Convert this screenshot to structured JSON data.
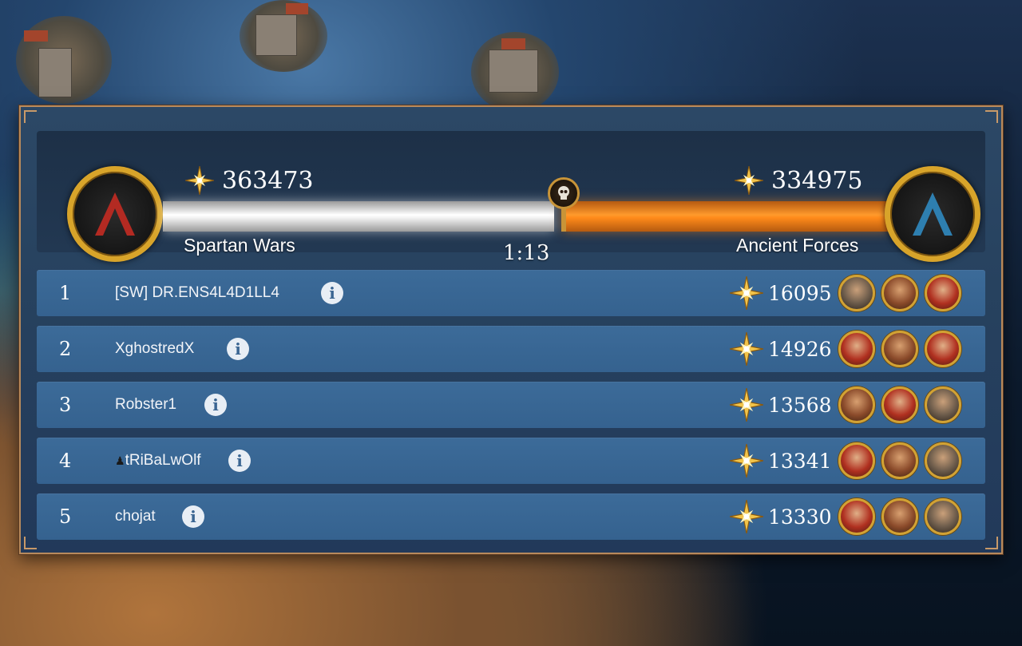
{
  "team_left": {
    "name": "Spartan Wars",
    "score": "363473"
  },
  "team_right": {
    "name": "Ancient Forces",
    "score": "334975"
  },
  "timer": "1:13",
  "tug_of_war": {
    "left_share": 0.52
  },
  "leaderboard": [
    {
      "rank": "1",
      "name": "[SW] DR.ENS4L4D1LL4",
      "score": "16095",
      "heroes": [
        "h3",
        "h1",
        "h2"
      ]
    },
    {
      "rank": "2",
      "name": "XghostredX",
      "score": "14926",
      "heroes": [
        "h2",
        "h1",
        "h2"
      ]
    },
    {
      "rank": "3",
      "name": "Robster1",
      "score": "13568",
      "heroes": [
        "h1",
        "h2",
        "h3"
      ]
    },
    {
      "rank": "4",
      "name": "tRiBaLwOlf",
      "score": "13341",
      "heroes": [
        "h2",
        "h1",
        "h3"
      ]
    },
    {
      "rank": "5",
      "name": "chojat",
      "score": "13330",
      "heroes": [
        "h2",
        "h1",
        "h3"
      ]
    }
  ],
  "colors": {
    "left_team": "#c0392b",
    "right_team": "#2e7fb0",
    "left_bar": "#ffffff",
    "right_bar": "#ff8a1a",
    "gold": "#d8a42a"
  },
  "icons": {
    "score": "star-compass-icon",
    "info": "info-icon",
    "timer_marker": "skull-icon"
  }
}
